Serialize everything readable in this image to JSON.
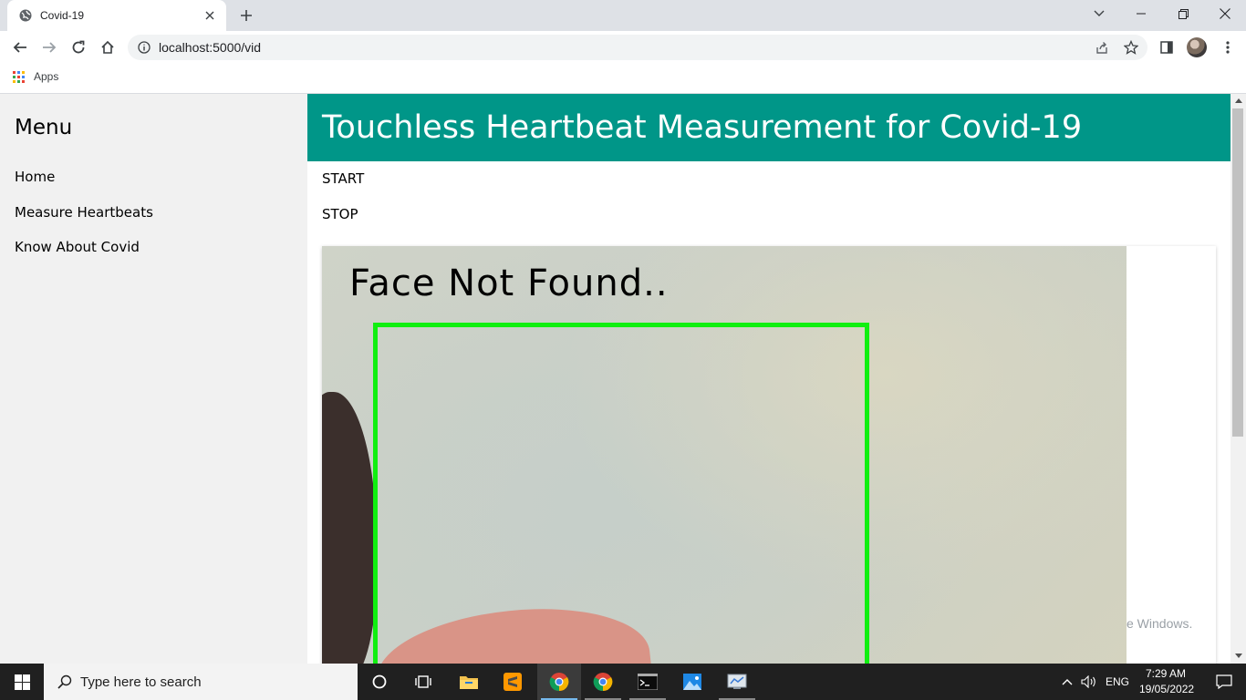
{
  "browser": {
    "tab_title": "Covid-19",
    "url": "localhost:5000/vid",
    "bookmarks": {
      "apps_label": "Apps"
    }
  },
  "sidebar": {
    "title": "Menu",
    "items": [
      {
        "label": "Home"
      },
      {
        "label": "Measure Heartbeats"
      },
      {
        "label": "Know About Covid"
      }
    ]
  },
  "main": {
    "header_title": "Touchless Heartbeat Measurement for Covid-19",
    "start_label": "START",
    "stop_label": "STOP",
    "video_overlay_text": "Face Not Found..",
    "watermark_text": "e Windows."
  },
  "colors": {
    "header_bg": "#009688",
    "face_box": "#10ef10",
    "taskbar": "#202020"
  },
  "taskbar": {
    "search_placeholder": "Type here to search",
    "language": "ENG",
    "time": "7:29 AM",
    "date": "19/05/2022",
    "apps": [
      "cortana-icon",
      "task-view-icon",
      "file-explorer-icon",
      "sublime-text-icon",
      "chrome-icon",
      "chrome-icon",
      "terminal-icon",
      "photos-icon",
      "network-app-icon"
    ]
  }
}
